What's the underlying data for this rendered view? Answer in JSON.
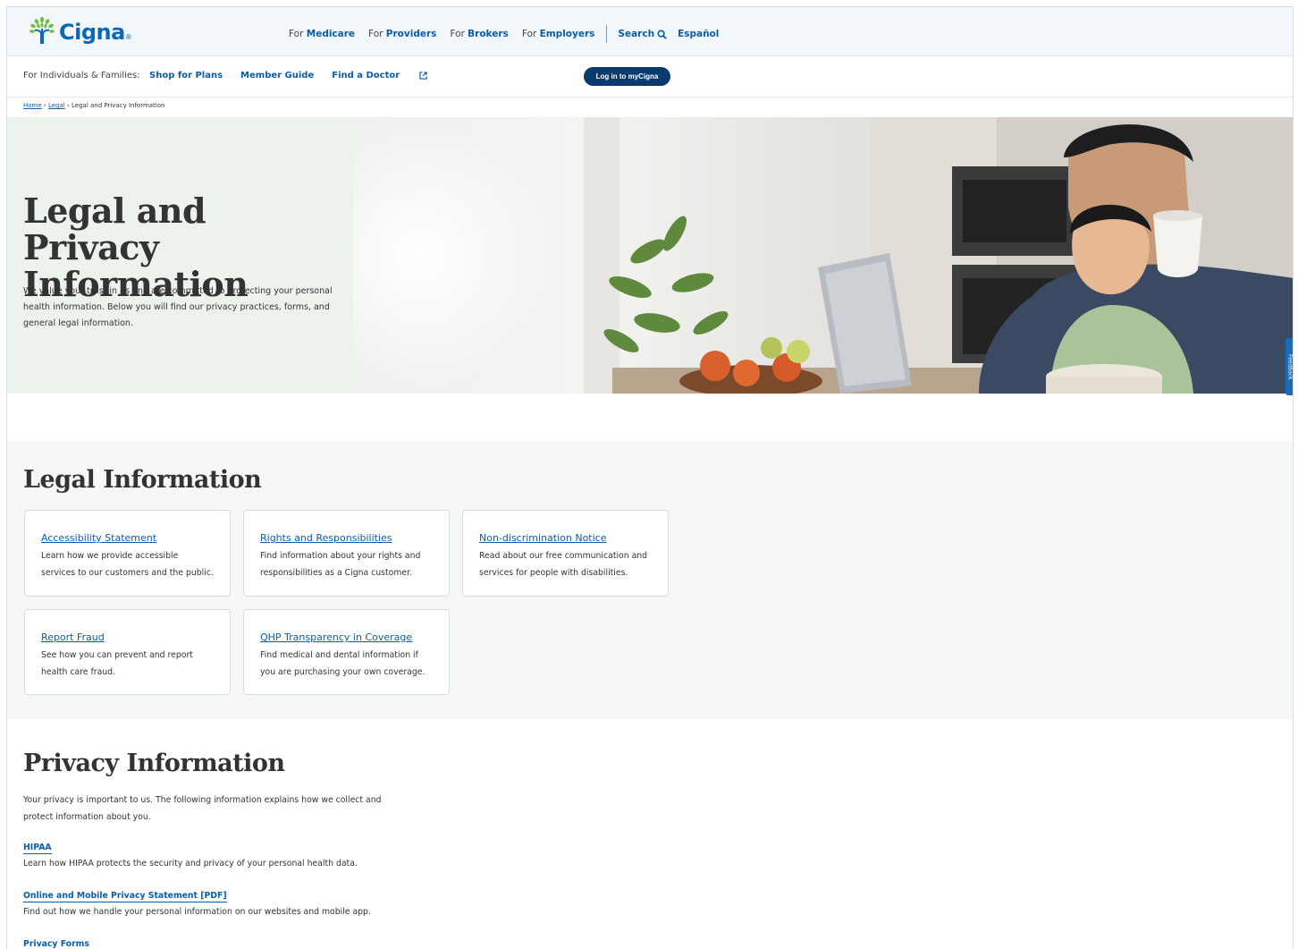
{
  "colors": {
    "brand_blue": "#0a68b5",
    "link_blue": "#0a5ea8",
    "button_navy": "#0b3b6e",
    "hero_green": "#ecf3ec",
    "section_bg": "#f5f8f7"
  },
  "header": {
    "logo_text": "Cigna",
    "logo_icon": "tree-icon",
    "nav": [
      {
        "prefix": "For",
        "label": "Medicare"
      },
      {
        "prefix": "For",
        "label": "Providers"
      },
      {
        "prefix": "For",
        "label": "Brokers"
      },
      {
        "prefix": "For",
        "label": "Employers"
      }
    ],
    "search_label": "Search",
    "search_icon": "search-icon",
    "espanol_label": "Español"
  },
  "subnav": {
    "audience_label": "For Individuals & Families:",
    "links": [
      "Shop for Plans",
      "Member Guide",
      "Find a Doctor"
    ],
    "external_icon": "external-link-icon",
    "login_label": "Log in to myCigna"
  },
  "breadcrumb": {
    "items": [
      "Home",
      "Legal"
    ],
    "current": "Legal and Privacy Information",
    "separator": "›"
  },
  "hero": {
    "title_line1": "Legal and Privacy",
    "title_line2": "Information",
    "description": "We value your trust in us and are committed to protecting your personal health information. Below you will find our privacy practices, forms, and general legal information."
  },
  "feedback_label": "Feedback",
  "legal": {
    "title": "Legal Information",
    "cards": [
      {
        "title": "Accessibility Statement",
        "description": "Learn how we provide accessible services to our customers and the public."
      },
      {
        "title": "Rights and Responsibilities",
        "description": "Find information about your rights and responsibilities as a Cigna customer."
      },
      {
        "title": "Non-discrimination Notice",
        "description": "Read about our free communication and services for people with disabilities."
      },
      {
        "title": "Report Fraud",
        "description": "See how you can prevent and report health care fraud."
      },
      {
        "title": "QHP Transparency in Coverage",
        "description": "Find medical and dental information if you are purchasing your own coverage."
      }
    ]
  },
  "privacy": {
    "title": "Privacy Information",
    "intro": "Your privacy is important to us. The following information explains how we collect and protect information about you.",
    "items": [
      {
        "title": "HIPAA",
        "description": "Learn how HIPAA protects the security and privacy of your personal health data."
      },
      {
        "title": "Online and Mobile Privacy Statement [PDF]",
        "description": "Find out how we handle your personal information on our websites and mobile app."
      },
      {
        "title": "Privacy Forms",
        "description": ""
      }
    ]
  }
}
